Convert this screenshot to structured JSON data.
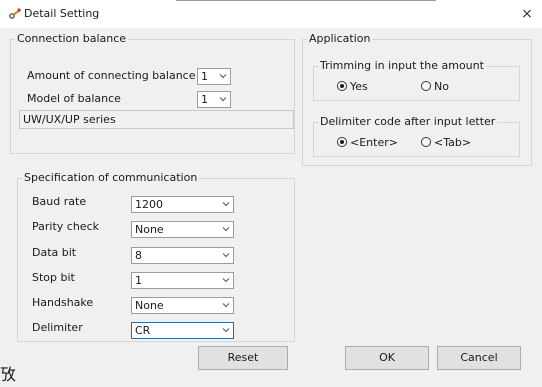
{
  "window": {
    "title": "Detail Setting",
    "close_glyph": "×",
    "stray_glyph": "攷"
  },
  "connection_balance": {
    "title": "Connection balance",
    "amount_label": "Amount of connecting balance",
    "amount_value": "1",
    "model_label": "Model of balance",
    "model_value": "1",
    "series_text": "UW/UX/UP series"
  },
  "application": {
    "title": "Application",
    "trimming": {
      "title": "Trimming in input the amount",
      "options": [
        "Yes",
        "No"
      ],
      "selected": "Yes"
    },
    "delimiter": {
      "title": "Delimiter code after input letter",
      "options": [
        "<Enter>",
        "<Tab>"
      ],
      "selected": "<Enter>"
    }
  },
  "communication": {
    "title": "Specification of communication",
    "rows": [
      {
        "label": "Baud rate",
        "value": "1200"
      },
      {
        "label": "Parity check",
        "value": "None"
      },
      {
        "label": "Data bit",
        "value": "8"
      },
      {
        "label": "Stop bit",
        "value": "1"
      },
      {
        "label": "Handshake",
        "value": "None"
      },
      {
        "label": "Delimiter",
        "value": "CR"
      }
    ]
  },
  "buttons": {
    "reset": "Reset",
    "ok": "OK",
    "cancel": "Cancel"
  },
  "icons": {
    "app": "gear-wrench-icon",
    "close": "close-icon",
    "dropdown": "chevron-down-icon"
  },
  "colors": {
    "focus_border": "#0078d7",
    "dialog_bg": "#f0f0f0"
  }
}
